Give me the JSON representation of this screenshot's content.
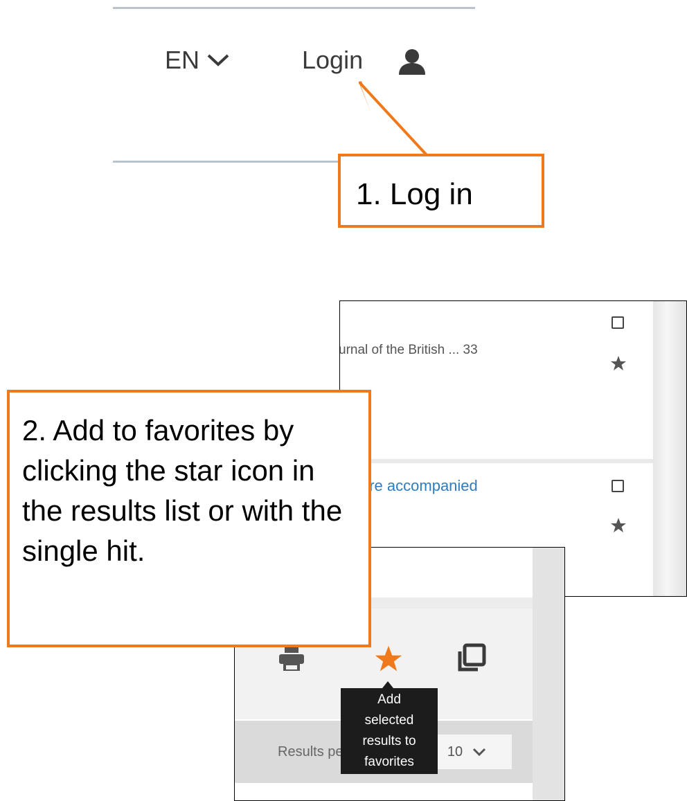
{
  "header": {
    "language": "EN",
    "login_label": "Login"
  },
  "callouts": {
    "step1": "1. Log in",
    "step2": "2. Add to favorites by clicking the star icon in the results list or with the single hit."
  },
  "results_list": {
    "item1_text": "urnal of the British ... 33",
    "item2_link": "ere accompanied"
  },
  "toolbar": {
    "tooltip_lines": [
      "Add",
      "selected",
      "results to",
      "favorites"
    ],
    "results_per_page_label": "Results per page",
    "per_page_value": "10"
  },
  "colors": {
    "callout_border": "#f07a1b",
    "star_active": "#f07a1b",
    "link": "#2e7cc0"
  },
  "icons": [
    "chevron-down-icon",
    "user-icon",
    "checkbox-icon",
    "star-icon",
    "print-icon",
    "copy-icon"
  ]
}
